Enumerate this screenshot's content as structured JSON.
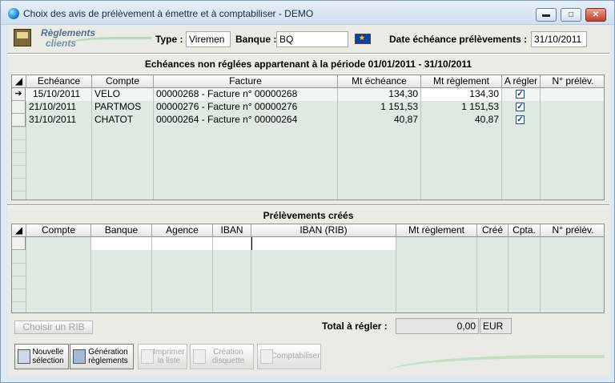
{
  "window": {
    "title": "Choix des avis de prélèvement à émettre et à comptabiliser - DEMO",
    "minimize": "▬",
    "maximize": "□",
    "close": "✕"
  },
  "logo": {
    "line1": "Règlements",
    "line2": "clients"
  },
  "header": {
    "type_label": "Type :",
    "type_value": "Viremen",
    "banque_label": "Banque :",
    "banque_value": "BQ",
    "date_label": "Date échéance prélèvements :",
    "date_value": "31/10/2011"
  },
  "echeances": {
    "title": "Echéances non réglées appartenant à la période 01/01/2011 - 31/10/2011",
    "columns": [
      "Echéance",
      "Compte",
      "Facture",
      "Mt échéance",
      "Mt règlement",
      "A régler",
      "N° prélèv."
    ],
    "rows": [
      {
        "echeance": "15/10/2011",
        "compte": "VELO",
        "facture": "00000268 - Facture n° 00000268",
        "mt_echeance": "134,30",
        "mt_reglement": "134,30",
        "a_regler": true,
        "num_prelev": ""
      },
      {
        "echeance": "21/10/2011",
        "compte": "PARTMOS",
        "facture": "00000276 - Facture n° 00000276",
        "mt_echeance": "1 151,53",
        "mt_reglement": "1 151,53",
        "a_regler": true,
        "num_prelev": ""
      },
      {
        "echeance": "31/10/2011",
        "compte": "CHATOT",
        "facture": "00000264 - Facture n° 00000264",
        "mt_echeance": "40,87",
        "mt_reglement": "40,87",
        "a_regler": true,
        "num_prelev": ""
      }
    ]
  },
  "prelevements": {
    "title": "Prélèvements créés",
    "columns": [
      "Compte",
      "Banque",
      "Agence",
      "IBAN",
      "IBAN (RIB)",
      "Mt règlement",
      "Créé",
      "Cpta.",
      "N° prélèv."
    ]
  },
  "footer": {
    "choisir_rib": "Choisir un RIB",
    "total_label": "Total à régler :",
    "total_value": "0,00",
    "currency": "EUR"
  },
  "toolbar": {
    "nouvelle_selection": [
      "Nouvelle",
      "sélection"
    ],
    "generation_reglements": [
      "Génération",
      "règlements"
    ],
    "imprimer_liste": [
      "Imprimer",
      "la liste"
    ],
    "creation_disquette": [
      "Création",
      "disquette"
    ],
    "comptabiliser": "Comptabiliser"
  },
  "colors": {
    "grid_bg": "#dfe9e4",
    "form_bg": "#ebebe6",
    "title_text": "#1b2b3c"
  }
}
